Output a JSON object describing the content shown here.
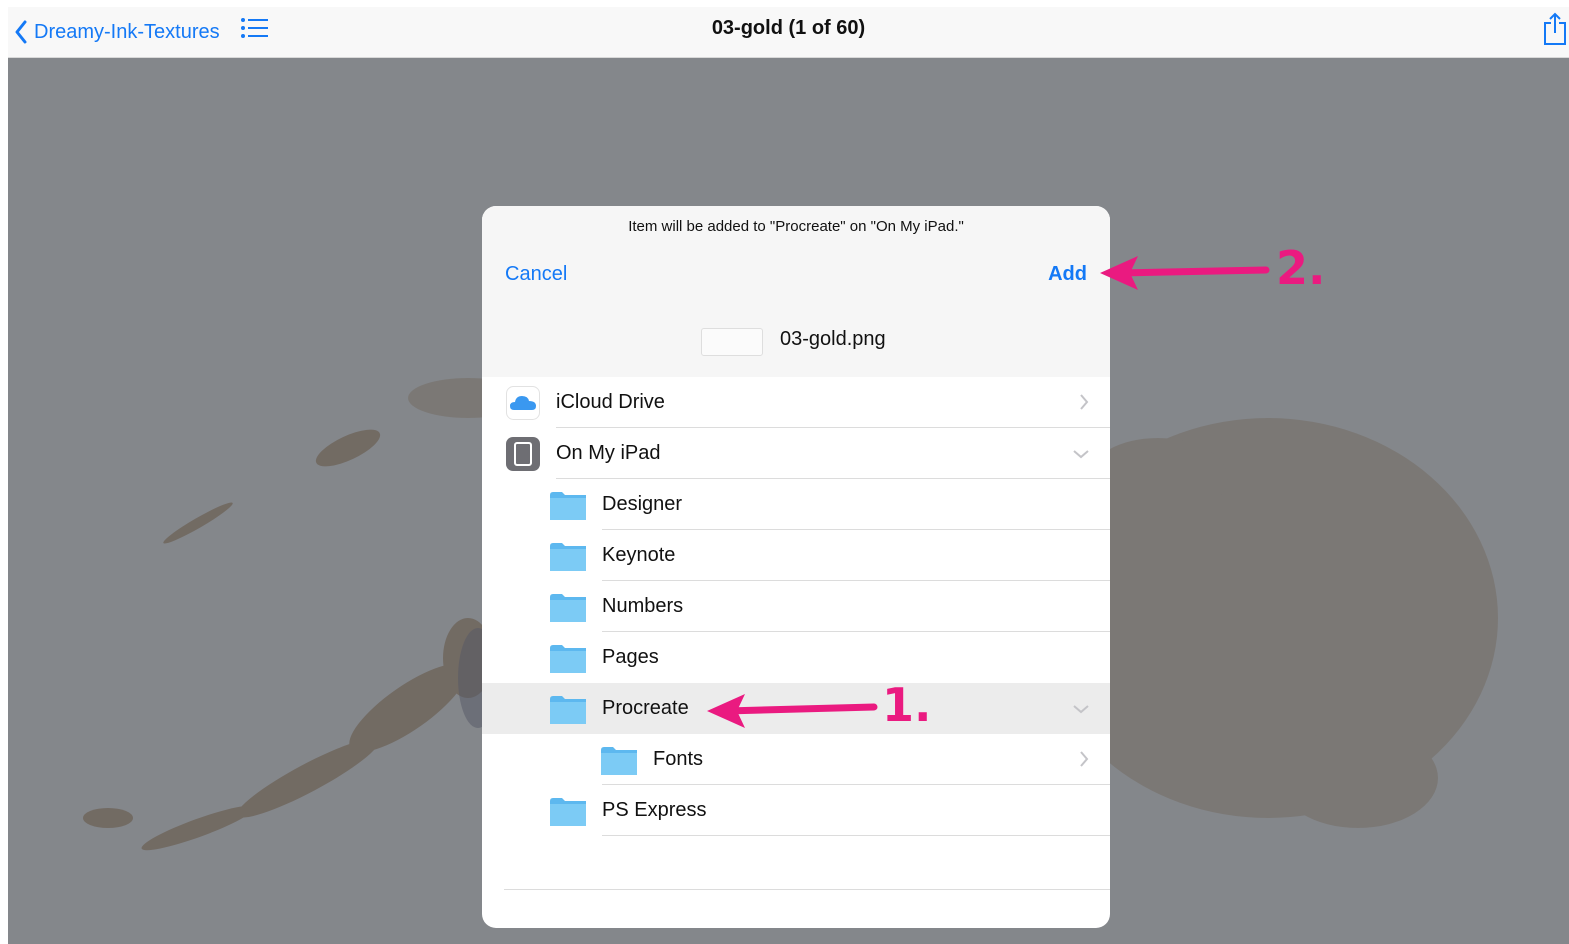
{
  "navbar": {
    "back_label": "Dreamy-Ink-Textures",
    "title": "03-gold (1 of 60)",
    "back_icon": "chevron-left-icon",
    "list_icon": "list-icon",
    "share_icon": "share-icon"
  },
  "dialog": {
    "message": "Item will be added to \"Procreate\" on \"On My iPad.\"",
    "cancel_label": "Cancel",
    "add_label": "Add",
    "file_name": "03-gold.png"
  },
  "locations": [
    {
      "label": "iCloud Drive",
      "icon": "icloud-icon",
      "chevron": "chevron-right"
    },
    {
      "label": "On My iPad",
      "icon": "ipad-icon",
      "chevron": "chevron-down"
    },
    {
      "label": "Designer",
      "icon": "folder-icon"
    },
    {
      "label": "Keynote",
      "icon": "folder-icon"
    },
    {
      "label": "Numbers",
      "icon": "folder-icon"
    },
    {
      "label": "Pages",
      "icon": "folder-icon"
    },
    {
      "label": "Procreate",
      "icon": "folder-icon",
      "chevron": "chevron-down",
      "selected": true
    },
    {
      "label": "Fonts",
      "icon": "folder-icon",
      "chevron": "chevron-right"
    },
    {
      "label": "PS Express",
      "icon": "folder-icon"
    }
  ],
  "annotations": {
    "step1": "1.",
    "step2": "2.",
    "color": "#ea1a80"
  },
  "colors": {
    "accent": "#1479f6",
    "folder": "#6fc3f3",
    "annotation": "#ea1a80"
  }
}
